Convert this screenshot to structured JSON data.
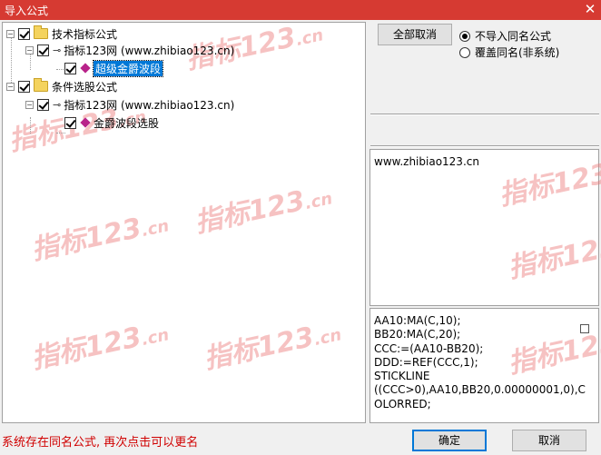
{
  "window": {
    "title": "导入公式",
    "close_glyph": "✕"
  },
  "tree": {
    "root1_label": "技术指标公式",
    "root1_child_label": "指标123网 (www.zhibiao123.cn)",
    "root1_leaf_label": "超级金爵波段",
    "root2_label": "条件选股公式",
    "root2_child_label": "指标123网 (www.zhibiao123.cn)",
    "root2_leaf_label": "金爵波段选股"
  },
  "watermark": {
    "main": "指标123",
    "suffix": ".cn"
  },
  "buttons": {
    "cancel_all": "全部取消",
    "ok": "确定",
    "cancel": "取消"
  },
  "options": {
    "no_import": "不导入同名公式",
    "overwrite": "覆盖同名(非系统)",
    "selected": "不导入同名公式"
  },
  "info": {
    "url": "www.zhibiao123.cn"
  },
  "code": {
    "lines": [
      "AA10:MA(C,10);",
      "BB20:MA(C,20);",
      "CCC:=(AA10-BB20);",
      "DDD:=REF(CCC,1);",
      "STICKLINE",
      "((CCC>0),AA10,BB20,0.00000001,0),C",
      "OLORRED;"
    ]
  },
  "status": {
    "message": "系统存在同名公式, 再次点击可以更名"
  },
  "icons": [
    "folder-icon",
    "key-icon",
    "formula-icon",
    "close-icon"
  ],
  "colors": {
    "titlebar": "#d63a32",
    "status_text": "#d00000",
    "selection": "#0078d7"
  }
}
